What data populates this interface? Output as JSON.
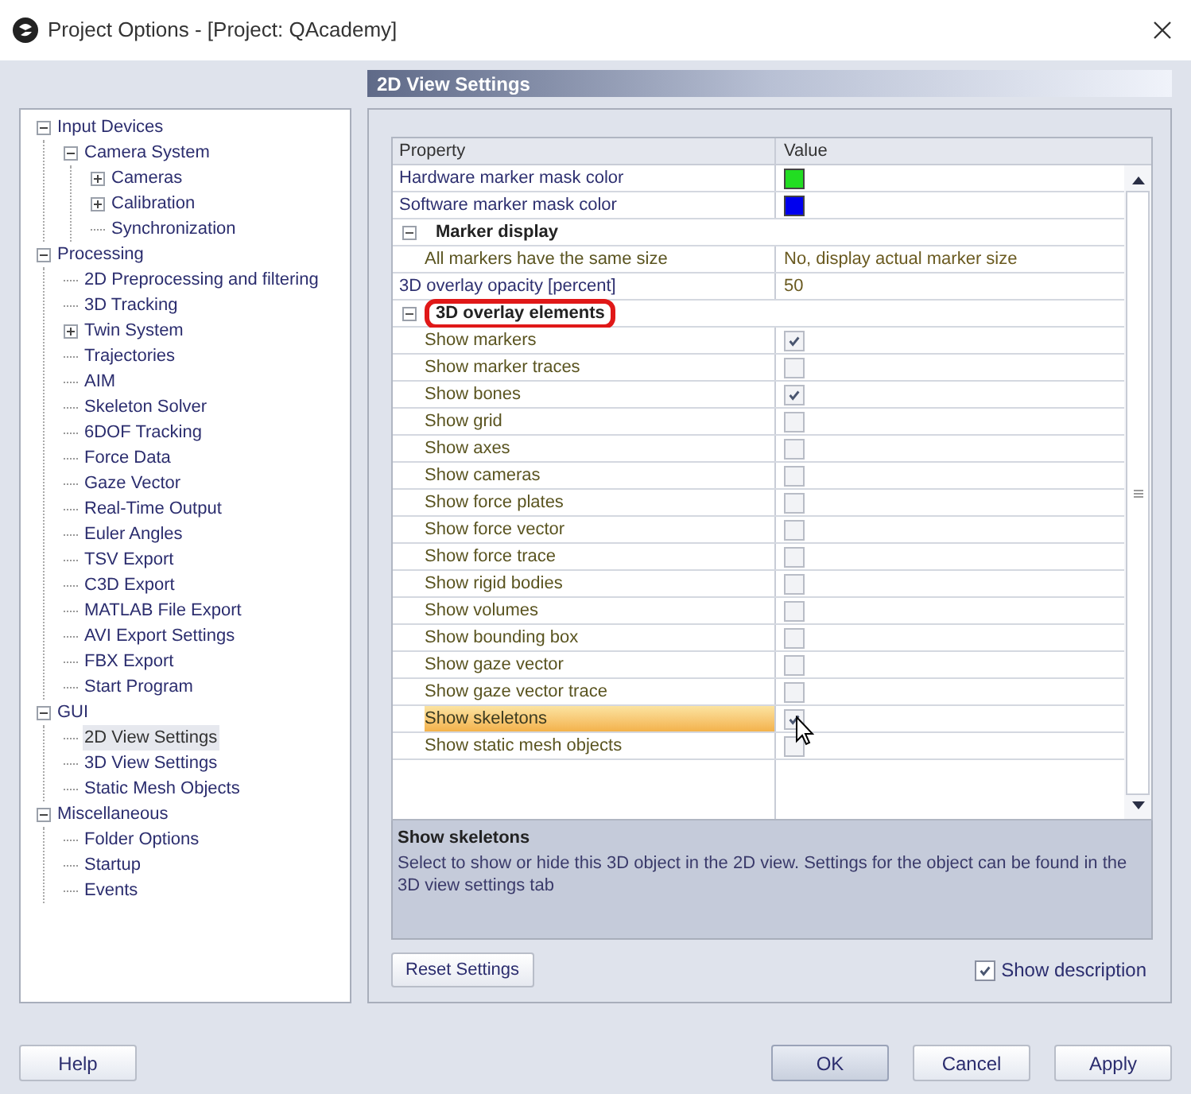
{
  "window": {
    "title": "Project Options - [Project: QAcademy]"
  },
  "tree": [
    {
      "label": "Input Devices",
      "expanded": true,
      "selected": false,
      "children": [
        {
          "label": "Camera System",
          "expanded": true,
          "selected": false,
          "children": [
            {
              "label": "Cameras",
              "expanded": false,
              "selected": false
            },
            {
              "label": "Calibration",
              "expanded": false,
              "selected": false
            },
            {
              "label": "Synchronization",
              "selected": false
            }
          ]
        }
      ]
    },
    {
      "label": "Processing",
      "expanded": true,
      "selected": false,
      "children": [
        {
          "label": "2D Preprocessing and filtering",
          "selected": false
        },
        {
          "label": "3D Tracking",
          "selected": false
        },
        {
          "label": "Twin System",
          "expanded": false,
          "selected": false
        },
        {
          "label": "Trajectories",
          "selected": false
        },
        {
          "label": "AIM",
          "selected": false
        },
        {
          "label": "Skeleton Solver",
          "selected": false
        },
        {
          "label": "6DOF Tracking",
          "selected": false
        },
        {
          "label": "Force Data",
          "selected": false
        },
        {
          "label": "Gaze Vector",
          "selected": false
        },
        {
          "label": "Real-Time Output",
          "selected": false
        },
        {
          "label": "Euler Angles",
          "selected": false
        },
        {
          "label": "TSV Export",
          "selected": false
        },
        {
          "label": "C3D Export",
          "selected": false
        },
        {
          "label": "MATLAB File Export",
          "selected": false
        },
        {
          "label": "AVI Export Settings",
          "selected": false
        },
        {
          "label": "FBX Export",
          "selected": false
        },
        {
          "label": "Start Program",
          "selected": false
        }
      ]
    },
    {
      "label": "GUI",
      "expanded": true,
      "selected": false,
      "children": [
        {
          "label": "2D View Settings",
          "selected": true
        },
        {
          "label": "3D View Settings",
          "selected": false
        },
        {
          "label": "Static Mesh Objects",
          "selected": false
        }
      ]
    },
    {
      "label": "Miscellaneous",
      "expanded": true,
      "selected": false,
      "children": [
        {
          "label": "Folder Options",
          "selected": false
        },
        {
          "label": "Startup",
          "selected": false
        },
        {
          "label": "Events",
          "selected": false
        }
      ]
    }
  ],
  "panel_title": "2D View Settings",
  "grid": {
    "columns": [
      "Property",
      "Value"
    ],
    "rows": [
      {
        "kind": "color",
        "label": "Hardware marker mask color",
        "color": "#22dd22",
        "nested": false,
        "selected": false
      },
      {
        "kind": "color",
        "label": "Software marker mask color",
        "color": "#0000ee",
        "nested": false,
        "selected": false
      },
      {
        "kind": "category",
        "label": "Marker display",
        "expanded": true,
        "annotated": false
      },
      {
        "kind": "text",
        "label": "All markers have the same size",
        "value": "No, display actual marker size",
        "nested": true,
        "selected": false
      },
      {
        "kind": "text",
        "label": "3D overlay opacity [percent]",
        "value": "50",
        "nested": false,
        "selected": false
      },
      {
        "kind": "category",
        "label": "3D overlay elements",
        "expanded": true,
        "annotated": true
      },
      {
        "kind": "check",
        "label": "Show markers",
        "checked": true,
        "nested": true,
        "selected": false
      },
      {
        "kind": "check",
        "label": "Show marker traces",
        "checked": false,
        "nested": true,
        "selected": false
      },
      {
        "kind": "check",
        "label": "Show bones",
        "checked": true,
        "nested": true,
        "selected": false
      },
      {
        "kind": "check",
        "label": "Show grid",
        "checked": false,
        "nested": true,
        "selected": false
      },
      {
        "kind": "check",
        "label": "Show axes",
        "checked": false,
        "nested": true,
        "selected": false
      },
      {
        "kind": "check",
        "label": "Show cameras",
        "checked": false,
        "nested": true,
        "selected": false
      },
      {
        "kind": "check",
        "label": "Show force plates",
        "checked": false,
        "nested": true,
        "selected": false
      },
      {
        "kind": "check",
        "label": "Show force vector",
        "checked": false,
        "nested": true,
        "selected": false
      },
      {
        "kind": "check",
        "label": "Show force trace",
        "checked": false,
        "nested": true,
        "selected": false
      },
      {
        "kind": "check",
        "label": "Show rigid bodies",
        "checked": false,
        "nested": true,
        "selected": false
      },
      {
        "kind": "check",
        "label": "Show volumes",
        "checked": false,
        "nested": true,
        "selected": false
      },
      {
        "kind": "check",
        "label": "Show bounding box",
        "checked": false,
        "nested": true,
        "selected": false
      },
      {
        "kind": "check",
        "label": "Show gaze vector",
        "checked": false,
        "nested": true,
        "selected": false
      },
      {
        "kind": "check",
        "label": "Show gaze vector trace",
        "checked": false,
        "nested": true,
        "selected": false
      },
      {
        "kind": "check",
        "label": "Show skeletons",
        "checked": true,
        "nested": true,
        "selected": true
      },
      {
        "kind": "check",
        "label": "Show static mesh objects",
        "checked": false,
        "nested": true,
        "selected": false
      }
    ]
  },
  "description": {
    "title": "Show skeletons",
    "text": "Select to show or hide this 3D object in the 2D view. Settings for the object can be found in the 3D view settings tab"
  },
  "reset_button": "Reset Settings",
  "show_description": {
    "label": "Show description",
    "checked": true
  },
  "buttons": [
    {
      "label": "Help",
      "kind": "help",
      "default": false
    },
    {
      "label": "OK",
      "kind": "dialog",
      "default": true
    },
    {
      "label": "Cancel",
      "kind": "dialog",
      "default": false
    },
    {
      "label": "Apply",
      "kind": "dialog",
      "default": false
    }
  ]
}
